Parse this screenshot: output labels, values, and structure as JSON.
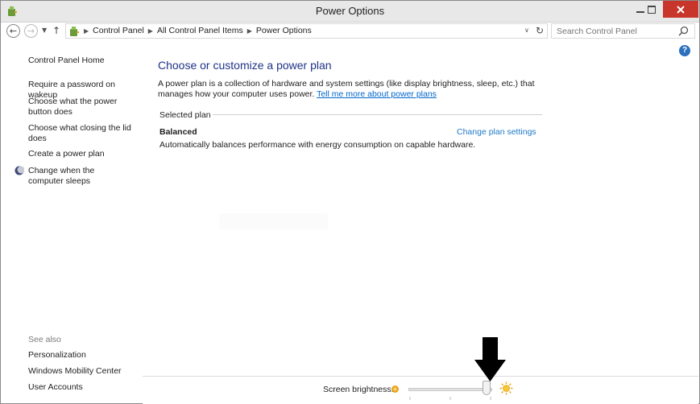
{
  "window": {
    "title": "Power Options",
    "colors": {
      "close_button": "#c7352b",
      "title_text": "#1e3287",
      "link": "#0066cc",
      "accent_link": "#1e78c8"
    }
  },
  "addressbar": {
    "breadcrumbs": [
      "Control Panel",
      "All Control Panel Items",
      "Power Options"
    ],
    "search_placeholder": "Search Control Panel"
  },
  "sidebar": {
    "home": "Control Panel Home",
    "links": [
      "Require a password on wakeup",
      "Choose what the power button does",
      "Choose what closing the lid does",
      "Create a power plan",
      "Change when the computer sleeps"
    ],
    "see_also_header": "See also",
    "see_also": [
      "Personalization",
      "Windows Mobility Center",
      "User Accounts"
    ]
  },
  "main": {
    "title": "Choose or customize a power plan",
    "description": "A power plan is a collection of hardware and system settings (like display brightness, sleep, etc.) that manages how your computer uses power.",
    "description_link": "Tell me more about power plans",
    "group_label": "Selected plan",
    "plan": {
      "name": "Balanced",
      "description": "Automatically balances performance with energy consumption on capable hardware.",
      "change_link": "Change plan settings"
    }
  },
  "brightness": {
    "label": "Screen brightness:",
    "level_fraction": 0.93
  },
  "icons": {
    "app": "power-options-icon",
    "help": "help-icon",
    "annotation": "arrow-down-annotation"
  }
}
